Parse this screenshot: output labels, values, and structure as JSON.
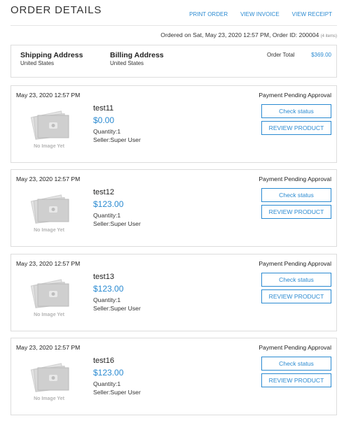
{
  "header": {
    "title": "ORDER DETAILS",
    "links": [
      "PRINT ORDER",
      "VIEW INVOICE",
      "VIEW RECEIPT"
    ]
  },
  "order_meta": {
    "text": "Ordered on Sat, May 23, 2020 12:57 PM, Order ID: 200004",
    "items": "(4 items)"
  },
  "addresses": {
    "shipping_title": "Shipping Address",
    "shipping_value": "United States",
    "billing_title": "Billing Address",
    "billing_value": "United States",
    "order_total_label": "Order Total",
    "order_total_value": "$369.00"
  },
  "thumbnail_caption": "No Image Yet",
  "items": [
    {
      "date": "May 23, 2020 12:57 PM",
      "status": "Payment Pending Approval",
      "name": "test11",
      "price": "$0.00",
      "quantity": "Quantity:1",
      "seller": "Seller:Super User",
      "check_label": "Check status",
      "review_label": "REVIEW PRODUCT"
    },
    {
      "date": "May 23, 2020 12:57 PM",
      "status": "Payment Pending Approval",
      "name": "test12",
      "price": "$123.00",
      "quantity": "Quantity:1",
      "seller": "Seller:Super User",
      "check_label": "Check status",
      "review_label": "REVIEW PRODUCT"
    },
    {
      "date": "May 23, 2020 12:57 PM",
      "status": "Payment Pending Approval",
      "name": "test13",
      "price": "$123.00",
      "quantity": "Quantity:1",
      "seller": "Seller:Super User",
      "check_label": "Check status",
      "review_label": "REVIEW PRODUCT"
    },
    {
      "date": "May 23, 2020 12:57 PM",
      "status": "Payment Pending Approval",
      "name": "test16",
      "price": "$123.00",
      "quantity": "Quantity:1",
      "seller": "Seller:Super User",
      "check_label": "Check status",
      "review_label": "REVIEW PRODUCT"
    }
  ],
  "colors": {
    "accent": "#2a8ad1",
    "border": "#dddddd"
  }
}
